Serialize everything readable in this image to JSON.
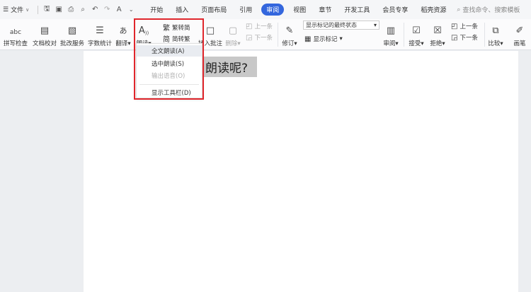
{
  "menubar": {
    "menu_icon": "hamburger-icon",
    "file_label": "文件",
    "tabs": [
      "开始",
      "插入",
      "页面布局",
      "引用",
      "审阅",
      "视图",
      "章节",
      "开发工具",
      "会员专享",
      "稻壳资源"
    ],
    "active_tab": "审阅",
    "search_text": "查找命令、搜索模板"
  },
  "ribbon": {
    "spell_check": "拼写检查",
    "doc_proof": "文档校对",
    "batch_edit": "批改服务",
    "word_count": "字数统计",
    "translate": "翻译",
    "read_aloud": "朗读",
    "trad_to_simp": "繁转简",
    "simp_to_trad": "简转繁",
    "insert_comment": "插入批注",
    "delete": "删除",
    "prev_comment": "上一条",
    "next_comment": "下一条",
    "track_changes": "修订",
    "markup_state": "显示标记的最终状态",
    "show_markup": "显示标记",
    "review": "审阅",
    "accept": "接受",
    "reject": "拒绝",
    "prev_change": "上一条",
    "next_change": "下一条",
    "compare": "比较",
    "pen": "画笔"
  },
  "document": {
    "highlighted_text": "朗读呢?"
  },
  "read_menu": {
    "items": [
      "全文朗读(A)",
      "选中朗读(S)",
      "输出语音(O)",
      "显示工具栏(D)"
    ]
  },
  "colors": {
    "accent": "#3366dd",
    "highlight_box": "#e0262c"
  }
}
